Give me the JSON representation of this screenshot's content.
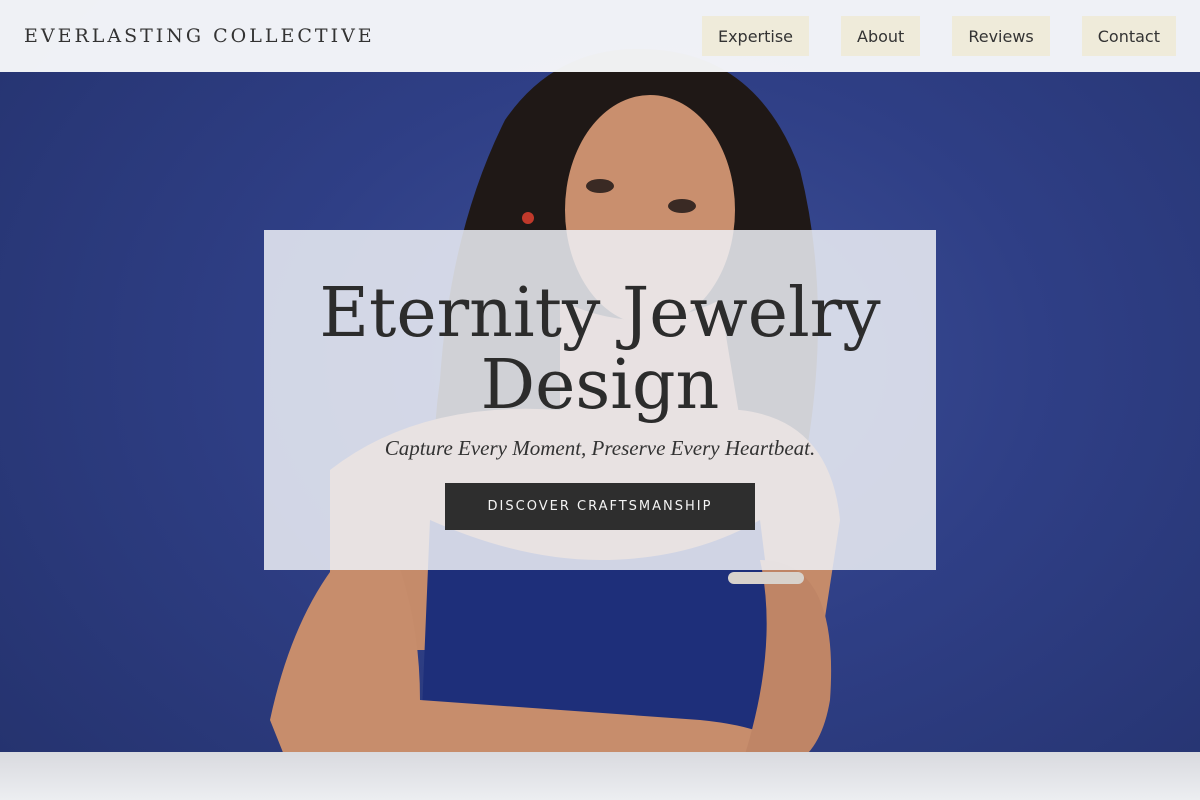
{
  "brand": {
    "name": "EVERLASTING COLLECTIVE"
  },
  "nav": {
    "items": [
      {
        "label": "Expertise"
      },
      {
        "label": "About"
      },
      {
        "label": "Reviews"
      },
      {
        "label": "Contact"
      }
    ]
  },
  "hero": {
    "title": "Eternity Jewelry Design",
    "tagline": "Capture Every Moment, Preserve Every Heartbeat.",
    "cta_label": "DISCOVER CRAFTSMANSHIP"
  },
  "colors": {
    "background": "#2f3f86",
    "nav_button": "#efebda",
    "cta": "#2e2e2e"
  }
}
